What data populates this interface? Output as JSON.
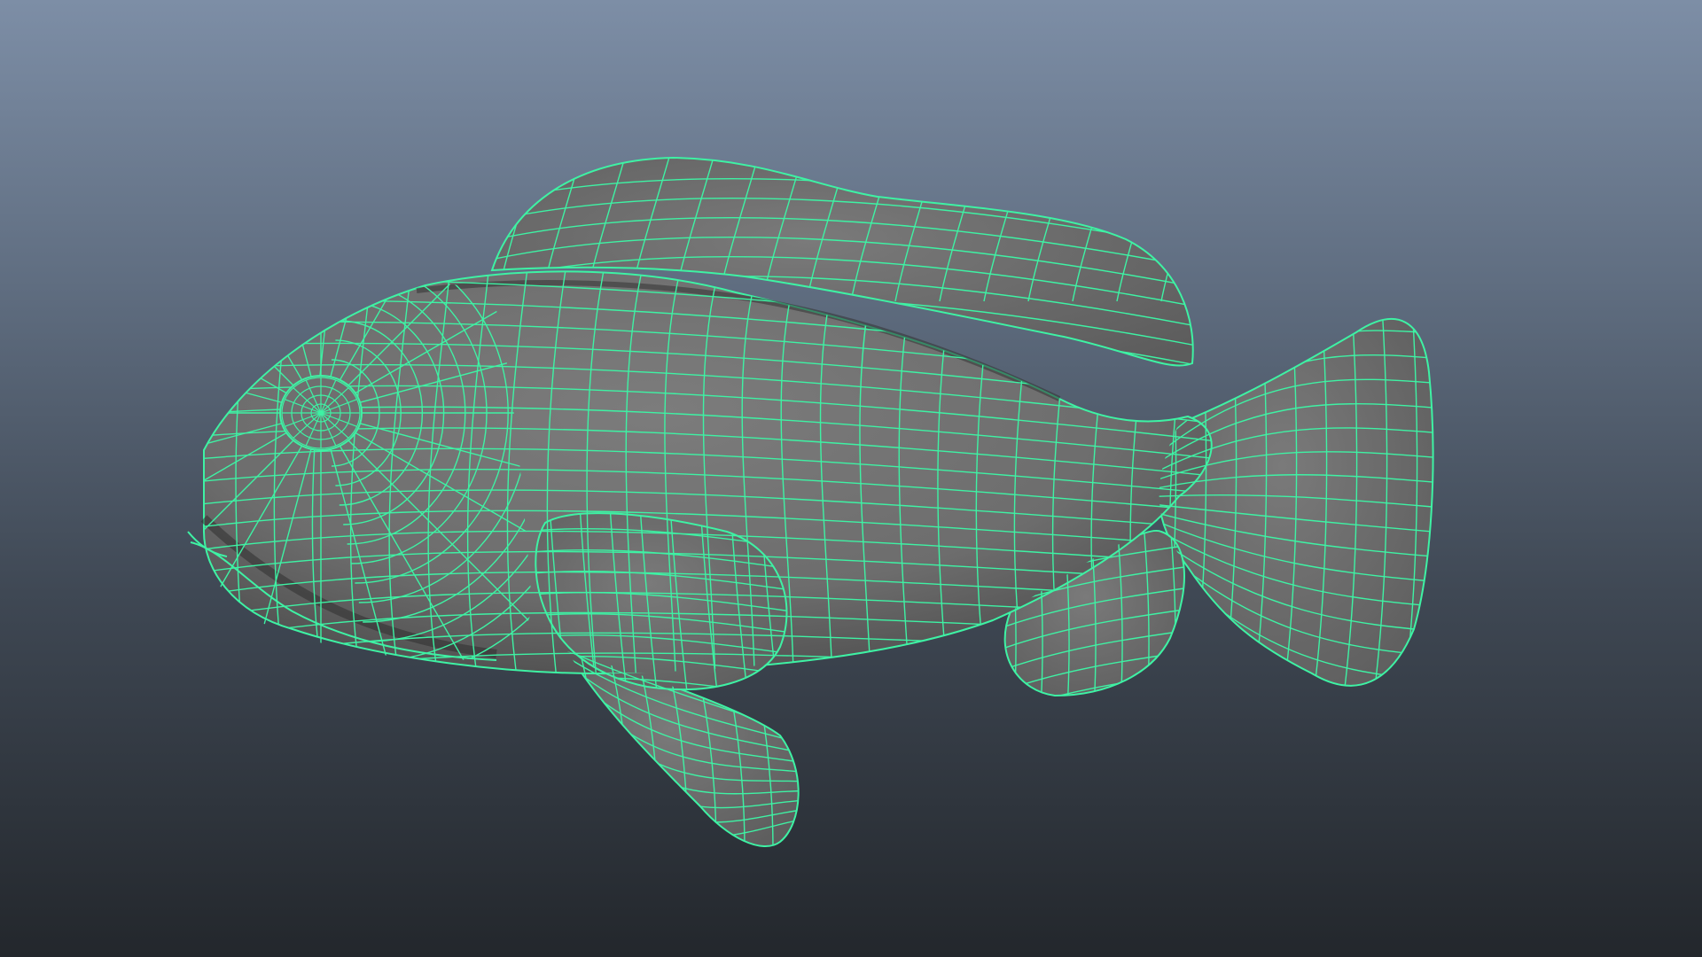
{
  "viewport": {
    "background_top": "#7d8ea6",
    "background_bottom": "#23272c"
  },
  "model": {
    "surface_color": "#6f6f6f",
    "shadow_color": "#3f3f3f",
    "wireframe_color": "#3ef2a4",
    "selection_state": "selected"
  }
}
